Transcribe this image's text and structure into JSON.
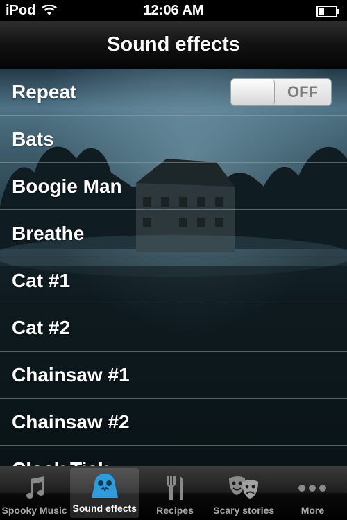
{
  "status_bar": {
    "carrier": "iPod",
    "time": "12:06 AM",
    "battery_level": 0.35
  },
  "navbar": {
    "title": "Sound effects"
  },
  "settings": {
    "repeat_label": "Repeat",
    "repeat_state": "OFF"
  },
  "sounds": [
    {
      "label": "Bats"
    },
    {
      "label": "Boogie Man"
    },
    {
      "label": "Breathe"
    },
    {
      "label": "Cat #1"
    },
    {
      "label": "Cat #2"
    },
    {
      "label": "Chainsaw #1"
    },
    {
      "label": "Chainsaw #2"
    },
    {
      "label": "Clock Tick"
    }
  ],
  "tabs": [
    {
      "label": "Spooky Music",
      "icon": "music-note-icon",
      "selected": false
    },
    {
      "label": "Sound effects",
      "icon": "ghost-icon",
      "selected": true
    },
    {
      "label": "Recipes",
      "icon": "fork-knife-icon",
      "selected": false
    },
    {
      "label": "Scary stories",
      "icon": "theater-masks-icon",
      "selected": false
    },
    {
      "label": "More",
      "icon": "more-dots-icon",
      "selected": false
    }
  ],
  "colors": {
    "tab_selected_icon": "#2f9cdc",
    "tab_icon": "#8a8a8a"
  }
}
